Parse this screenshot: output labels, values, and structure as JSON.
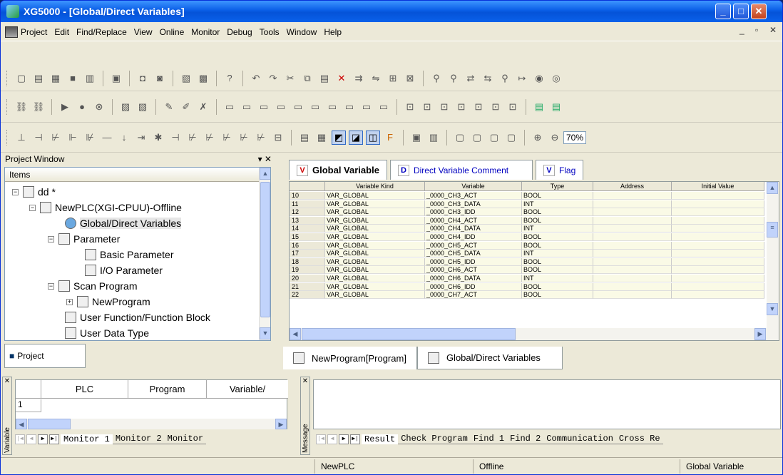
{
  "window": {
    "title": "XG5000 - [Global/Direct Variables]"
  },
  "menu": [
    "Project",
    "Edit",
    "Find/Replace",
    "View",
    "Online",
    "Monitor",
    "Debug",
    "Tools",
    "Window",
    "Help"
  ],
  "zoom": "70%",
  "project": {
    "panel_title": "Project Window",
    "items_header": "Items",
    "tree": [
      {
        "label": "dd *"
      },
      {
        "label": "NewPLC(XGI-CPUU)-Offline"
      },
      {
        "label": "Global/Direct Variables"
      },
      {
        "label": "Parameter"
      },
      {
        "label": "Basic Parameter"
      },
      {
        "label": "I/O Parameter"
      },
      {
        "label": "Scan Program"
      },
      {
        "label": "NewProgram"
      },
      {
        "label": "User Function/Function Block"
      },
      {
        "label": "User Data Type"
      }
    ],
    "tab": "Project"
  },
  "var_tabs": [
    "Global Variable",
    "Direct Variable Comment",
    "Flag"
  ],
  "grid": {
    "headers": [
      "Variable Kind",
      "Variable",
      "Type",
      "Address",
      "Initial Value"
    ],
    "rows": [
      [
        "10",
        "VAR_GLOBAL",
        "_0000_CH3_ACT",
        "BOOL"
      ],
      [
        "11",
        "VAR_GLOBAL",
        "_0000_CH3_DATA",
        "INT"
      ],
      [
        "12",
        "VAR_GLOBAL",
        "_0000_CH3_IDD",
        "BOOL"
      ],
      [
        "13",
        "VAR_GLOBAL",
        "_0000_CH4_ACT",
        "BOOL"
      ],
      [
        "14",
        "VAR_GLOBAL",
        "_0000_CH4_DATA",
        "INT"
      ],
      [
        "15",
        "VAR_GLOBAL",
        "_0000_CH4_IDD",
        "BOOL"
      ],
      [
        "16",
        "VAR_GLOBAL",
        "_0000_CH5_ACT",
        "BOOL"
      ],
      [
        "17",
        "VAR_GLOBAL",
        "_0000_CH5_DATA",
        "INT"
      ],
      [
        "18",
        "VAR_GLOBAL",
        "_0000_CH5_IDD",
        "BOOL"
      ],
      [
        "19",
        "VAR_GLOBAL",
        "_0000_CH6_ACT",
        "BOOL"
      ],
      [
        "20",
        "VAR_GLOBAL",
        "_0000_CH6_DATA",
        "INT"
      ],
      [
        "21",
        "VAR_GLOBAL",
        "_0000_CH6_IDD",
        "BOOL"
      ],
      [
        "22",
        "VAR_GLOBAL",
        "_0000_CH7_ACT",
        "BOOL"
      ]
    ]
  },
  "doc_tabs": [
    "NewProgram[Program]",
    "Global/Direct Variables"
  ],
  "variable_panel": {
    "side_label": "Variable",
    "headers": [
      "PLC",
      "Program",
      "Variable/"
    ],
    "row1": "1",
    "tabs": [
      "Monitor 1",
      "Monitor 2",
      "Monitor"
    ]
  },
  "message_panel": {
    "side_label": "Message",
    "tabs": [
      "Result",
      "Check Program",
      "Find 1",
      "Find 2",
      "Communication",
      "Cross Re"
    ]
  },
  "status": {
    "plc": "NewPLC",
    "mode": "Offline",
    "view": "Global Variable"
  }
}
